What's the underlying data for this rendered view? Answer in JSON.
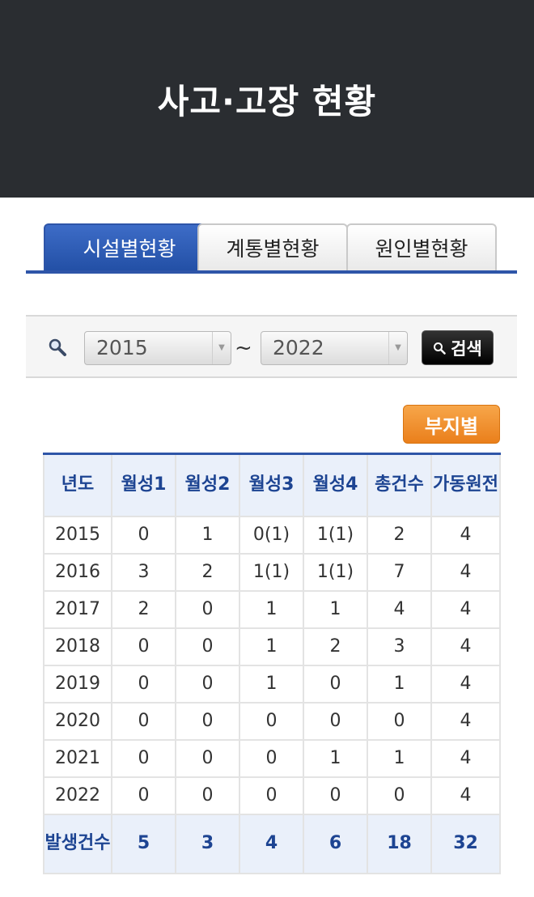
{
  "header": {
    "title": "사고·고장 현황"
  },
  "tabs": [
    {
      "label": "시설별현황",
      "active": true
    },
    {
      "label": "계통별현황",
      "active": false
    },
    {
      "label": "원인별현황",
      "active": false
    }
  ],
  "search": {
    "icon": "magnifier-icon",
    "from_year": "2015",
    "to_year": "2022",
    "separator": "~",
    "button_label": "검색"
  },
  "site_button": {
    "label": "부지별"
  },
  "table": {
    "headers": [
      "년도",
      "월성1",
      "월성2",
      "월성3",
      "월성4",
      "총건수",
      "가동원전"
    ],
    "rows": [
      [
        "2015",
        "0",
        "1",
        "0(1)",
        "1(1)",
        "2",
        "4"
      ],
      [
        "2016",
        "3",
        "2",
        "1(1)",
        "1(1)",
        "7",
        "4"
      ],
      [
        "2017",
        "2",
        "0",
        "1",
        "1",
        "4",
        "4"
      ],
      [
        "2018",
        "0",
        "0",
        "1",
        "2",
        "3",
        "4"
      ],
      [
        "2019",
        "0",
        "0",
        "1",
        "0",
        "1",
        "4"
      ],
      [
        "2020",
        "0",
        "0",
        "0",
        "0",
        "0",
        "4"
      ],
      [
        "2021",
        "0",
        "0",
        "0",
        "1",
        "1",
        "4"
      ],
      [
        "2022",
        "0",
        "0",
        "0",
        "0",
        "0",
        "4"
      ]
    ],
    "footer": [
      "발생건수",
      "5",
      "3",
      "4",
      "6",
      "18",
      "32"
    ]
  },
  "colors": {
    "header_bg": "#2a2d31",
    "accent_blue": "#2e55a8",
    "orange": "#ea7f1b"
  }
}
